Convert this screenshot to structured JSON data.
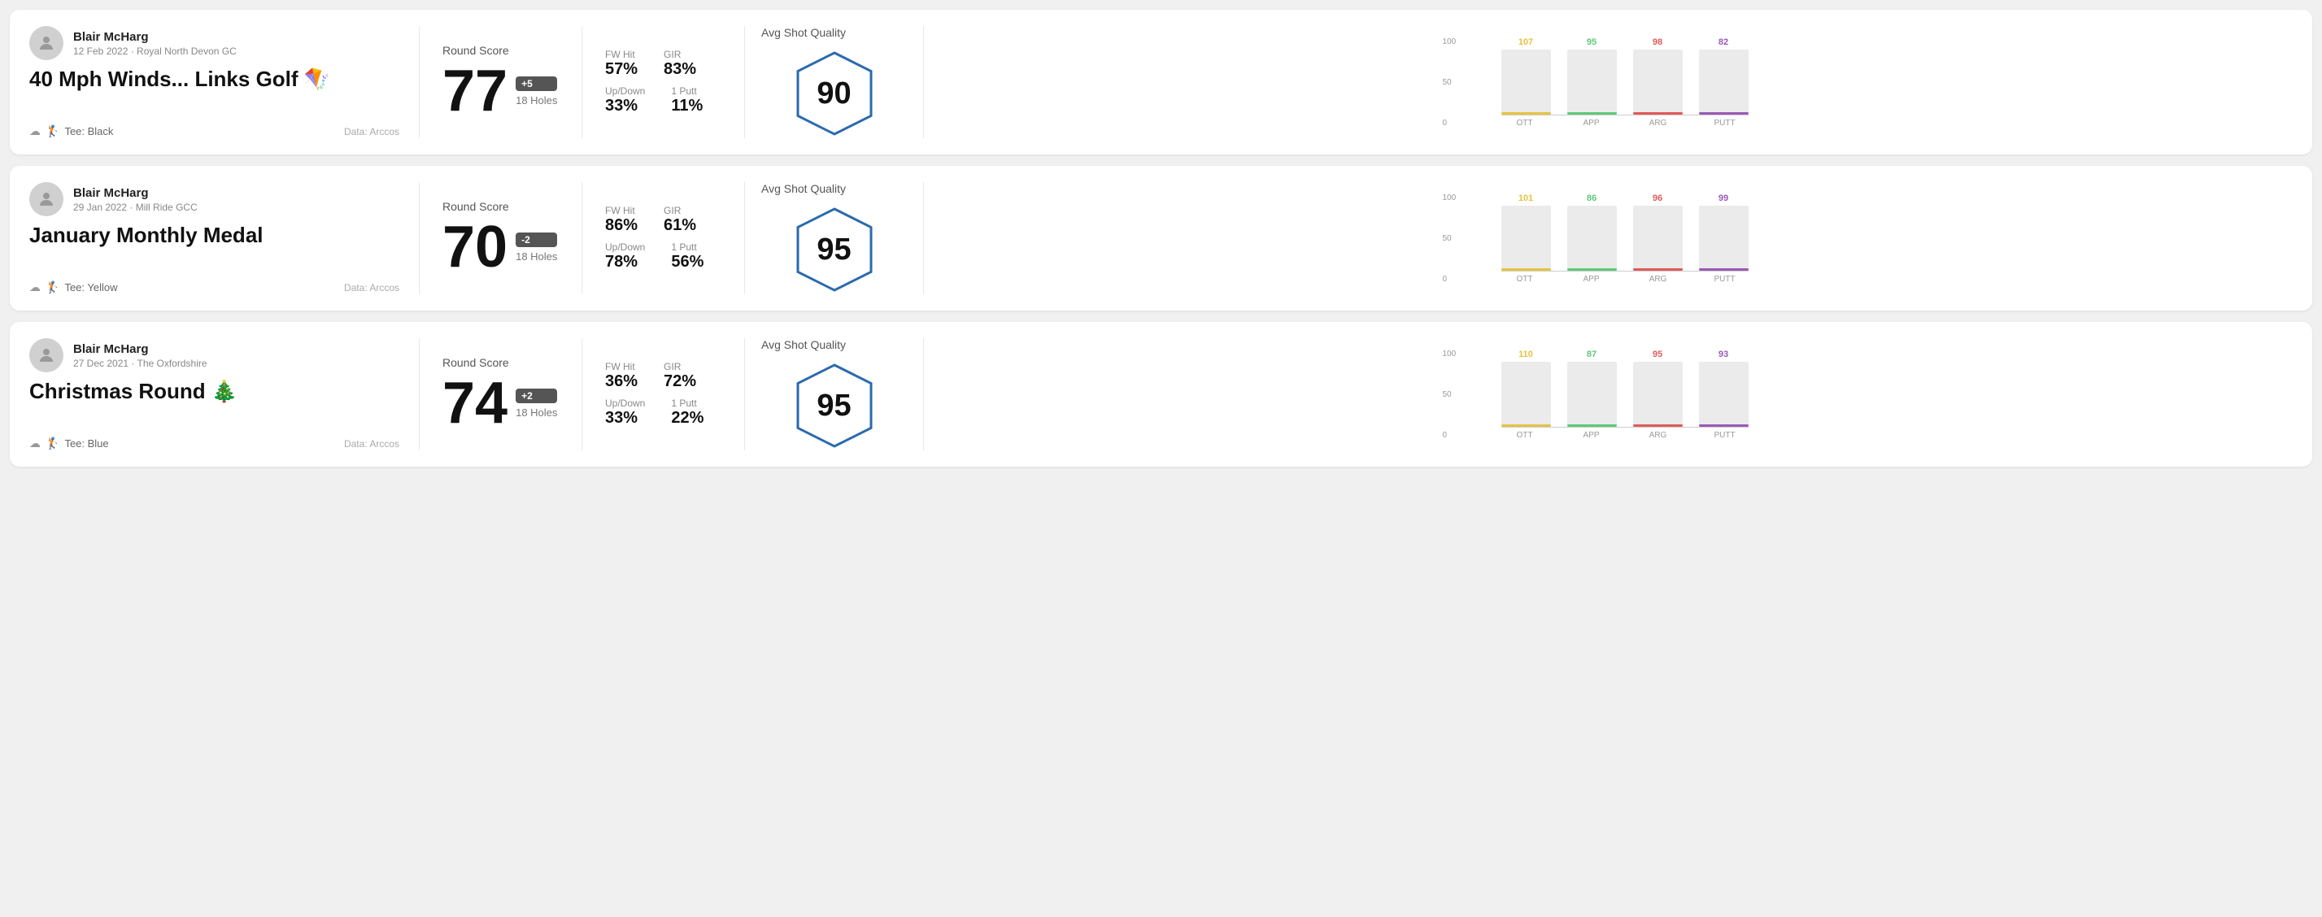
{
  "rounds": [
    {
      "id": "round1",
      "user_name": "Blair McHarg",
      "date": "12 Feb 2022 · Royal North Devon GC",
      "title": "40 Mph Winds... Links Golf 🪁",
      "tee": "Black",
      "data_source": "Data: Arccos",
      "score": "77",
      "score_badge": "+5",
      "score_badge_type": "positive",
      "holes": "18 Holes",
      "fw_hit": "57%",
      "gir": "83%",
      "up_down": "33%",
      "one_putt": "11%",
      "avg_shot_quality": "90",
      "quality_label": "Avg Shot Quality",
      "chart": {
        "bars": [
          {
            "label": "OTT",
            "value": 107,
            "color": "#e6c340"
          },
          {
            "label": "APP",
            "value": 95,
            "color": "#5dc97a"
          },
          {
            "label": "ARG",
            "value": 98,
            "color": "#e05a5a"
          },
          {
            "label": "PUTT",
            "value": 82,
            "color": "#9b59b6"
          }
        ],
        "max": 120
      }
    },
    {
      "id": "round2",
      "user_name": "Blair McHarg",
      "date": "29 Jan 2022 · Mill Ride GCC",
      "title": "January Monthly Medal",
      "tee": "Yellow",
      "data_source": "Data: Arccos",
      "score": "70",
      "score_badge": "-2",
      "score_badge_type": "negative",
      "holes": "18 Holes",
      "fw_hit": "86%",
      "gir": "61%",
      "up_down": "78%",
      "one_putt": "56%",
      "avg_shot_quality": "95",
      "quality_label": "Avg Shot Quality",
      "chart": {
        "bars": [
          {
            "label": "OTT",
            "value": 101,
            "color": "#e6c340"
          },
          {
            "label": "APP",
            "value": 86,
            "color": "#5dc97a"
          },
          {
            "label": "ARG",
            "value": 96,
            "color": "#e05a5a"
          },
          {
            "label": "PUTT",
            "value": 99,
            "color": "#9b59b6"
          }
        ],
        "max": 120
      }
    },
    {
      "id": "round3",
      "user_name": "Blair McHarg",
      "date": "27 Dec 2021 · The Oxfordshire",
      "title": "Christmas Round 🎄",
      "tee": "Blue",
      "data_source": "Data: Arccos",
      "score": "74",
      "score_badge": "+2",
      "score_badge_type": "positive",
      "holes": "18 Holes",
      "fw_hit": "36%",
      "gir": "72%",
      "up_down": "33%",
      "one_putt": "22%",
      "avg_shot_quality": "95",
      "quality_label": "Avg Shot Quality",
      "chart": {
        "bars": [
          {
            "label": "OTT",
            "value": 110,
            "color": "#e6c340"
          },
          {
            "label": "APP",
            "value": 87,
            "color": "#5dc97a"
          },
          {
            "label": "ARG",
            "value": 95,
            "color": "#e05a5a"
          },
          {
            "label": "PUTT",
            "value": 93,
            "color": "#9b59b6"
          }
        ],
        "max": 120
      }
    }
  ],
  "labels": {
    "round_score": "Round Score",
    "fw_hit": "FW Hit",
    "gir": "GIR",
    "up_down": "Up/Down",
    "one_putt": "1 Putt",
    "data_arccos": "Data: Arccos",
    "tee_label": "Tee:",
    "chart_y_100": "100",
    "chart_y_50": "50",
    "chart_y_0": "0"
  }
}
